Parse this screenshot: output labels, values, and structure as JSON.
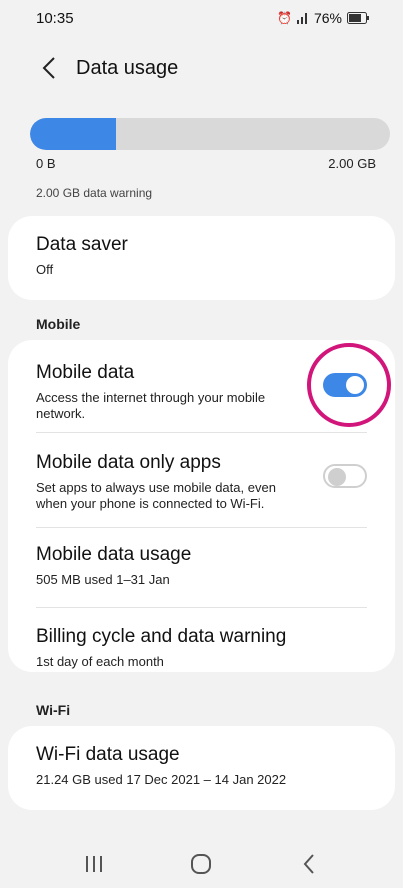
{
  "status_bar": {
    "time": "10:35",
    "battery": "76%",
    "icons": [
      "alarm-icon",
      "signal-icon",
      "battery-icon"
    ]
  },
  "header": {
    "title": "Data usage",
    "back_icon": "chevron-left-icon"
  },
  "usage_summary": {
    "used_fraction": 0.24,
    "min_label": "0 B",
    "max_label": "2.00 GB",
    "warning_label": "2.00 GB data warning",
    "fill_color": "#3d88e6"
  },
  "data_saver": {
    "title": "Data saver",
    "subtitle": "Off"
  },
  "mobile_section": {
    "label": "Mobile",
    "mobile_data": {
      "title": "Mobile data",
      "subtitle": "Access the internet through your mobile network.",
      "toggle": "on"
    },
    "data_only_apps": {
      "title": "Mobile data only apps",
      "subtitle": "Set apps to always use mobile data, even when your phone is connected to Wi-Fi.",
      "toggle": "off"
    },
    "mobile_data_usage": {
      "title": "Mobile data usage",
      "subtitle": "505 MB used 1–31 Jan"
    },
    "billing_cycle": {
      "title": "Billing cycle and data warning",
      "subtitle": "1st day of each month"
    }
  },
  "wifi_section": {
    "label": "Wi-Fi",
    "wifi_data_usage": {
      "title": "Wi-Fi data usage",
      "subtitle": "21.24 GB used 17 Dec 2021 – 14 Jan 2022"
    }
  },
  "nav_bar": {
    "icons": [
      "recent-apps-icon",
      "home-icon",
      "back-icon"
    ]
  },
  "highlight_color": "#d1157a"
}
